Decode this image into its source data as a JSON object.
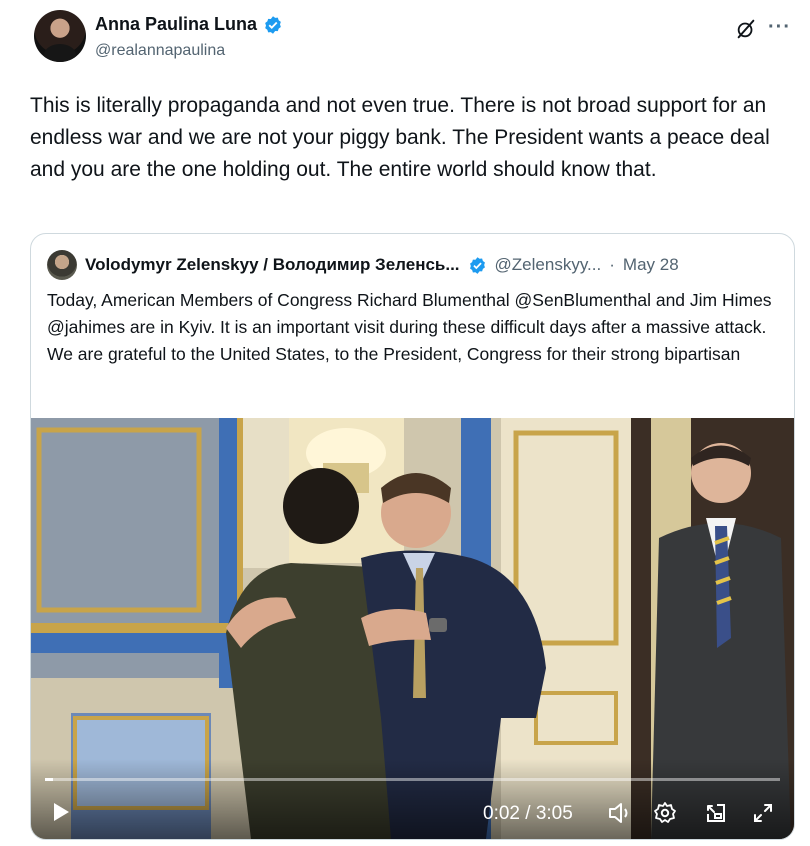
{
  "post": {
    "author_name": "Anna Paulina Luna",
    "author_handle": "@realannapaulina",
    "text": "This is literally propaganda and not even true. There is not broad support for an endless war and we are not your piggy bank. The President wants a peace deal and you are the one holding out. The entire world should know that."
  },
  "quoted_post": {
    "author_name": "Volodymyr Zelenskyy / Володимир Зеленсь...",
    "author_handle": "@Zelenskyy...",
    "separator": "·",
    "date": "May 28",
    "text": "Today, American Members of Congress Richard Blumenthal @SenBlumenthal and Jim Himes @jahimes are in Kyiv. It is an important visit during these difficult days after a massive attack. We are grateful to the United States, to the President, Congress for their strong bipartisan"
  },
  "video": {
    "time_display": "0:02 / 3:05",
    "progress_fraction": 0.011
  },
  "icons": {
    "verified": "verified-badge-icon",
    "grok": "grok-icon",
    "more": "more-icon",
    "play": "play-icon",
    "volume": "volume-icon",
    "settings": "settings-gear-icon",
    "pip": "picture-in-picture-icon",
    "fullscreen": "fullscreen-icon"
  },
  "colors": {
    "accent": "#1d9bf0",
    "text": "#0f1419",
    "muted": "#536471",
    "border": "#cfd9de"
  }
}
